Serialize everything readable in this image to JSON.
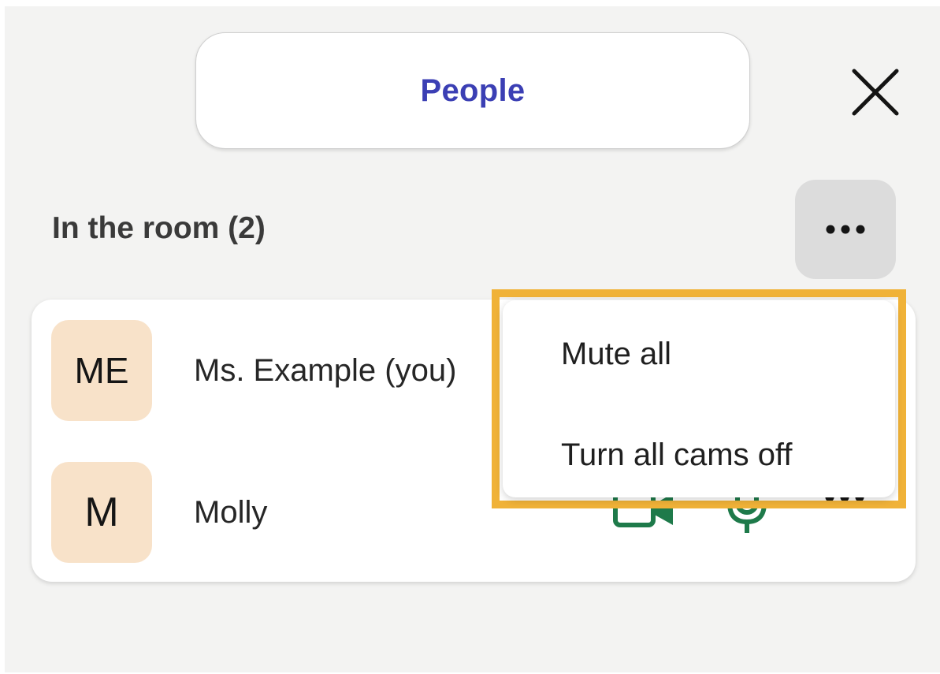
{
  "header": {
    "tab_label": "People"
  },
  "room": {
    "section_title": "In the room (2)"
  },
  "participants": [
    {
      "initials": "ME",
      "name": "Ms. Example (you)"
    },
    {
      "initials": "M",
      "name": "Molly"
    }
  ],
  "menu": {
    "items": [
      "Mute all",
      "Turn all cams off"
    ]
  },
  "icons": {
    "close": "close-icon",
    "more": "more-horizontal-icon",
    "camera": "video-camera-icon",
    "microphone": "microphone-icon"
  },
  "colors": {
    "accent": "#3b3fb4",
    "avatar_bg": "#f8e2c9",
    "highlight": "#f0b238",
    "icon_green": "#1e7a4a",
    "panel_bg": "#f3f3f2"
  }
}
